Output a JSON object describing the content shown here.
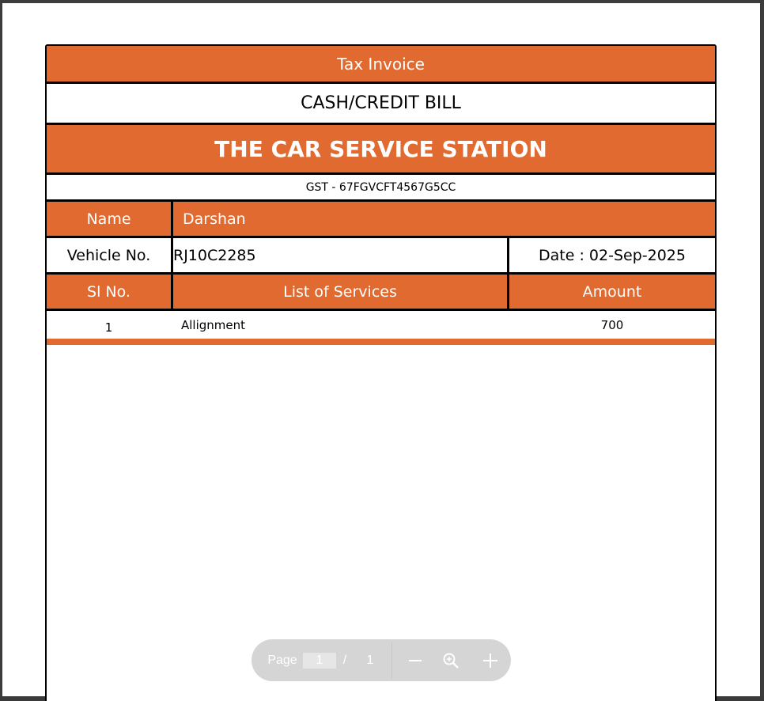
{
  "invoice": {
    "header": "Tax Invoice",
    "bill_type": "CASH/CREDIT BILL",
    "company": "THE CAR SERVICE STATION",
    "gst": "GST - 67FGVCFT4567G5CC",
    "name_label": "Name",
    "name_value": "Darshan",
    "vehicle_label": "Vehicle No.",
    "vehicle_value": "RJ10C2285",
    "date": "Date : 02-Sep-2025",
    "columns": {
      "sl": "Sl No.",
      "services": "List of Services",
      "amount": "Amount"
    },
    "items": [
      {
        "sl": "1",
        "service": "Allignment",
        "amount": "700"
      }
    ]
  },
  "toolbar": {
    "page_label": "Page",
    "current_page": "1",
    "separator": "/",
    "total_pages": "1",
    "zoom_out_icon": "minus-icon",
    "zoom_fit_icon": "zoom-icon",
    "zoom_in_icon": "plus-icon"
  },
  "colors": {
    "accent": "#e06a30",
    "border": "#000000",
    "toolbar": "#d5d5d5"
  }
}
